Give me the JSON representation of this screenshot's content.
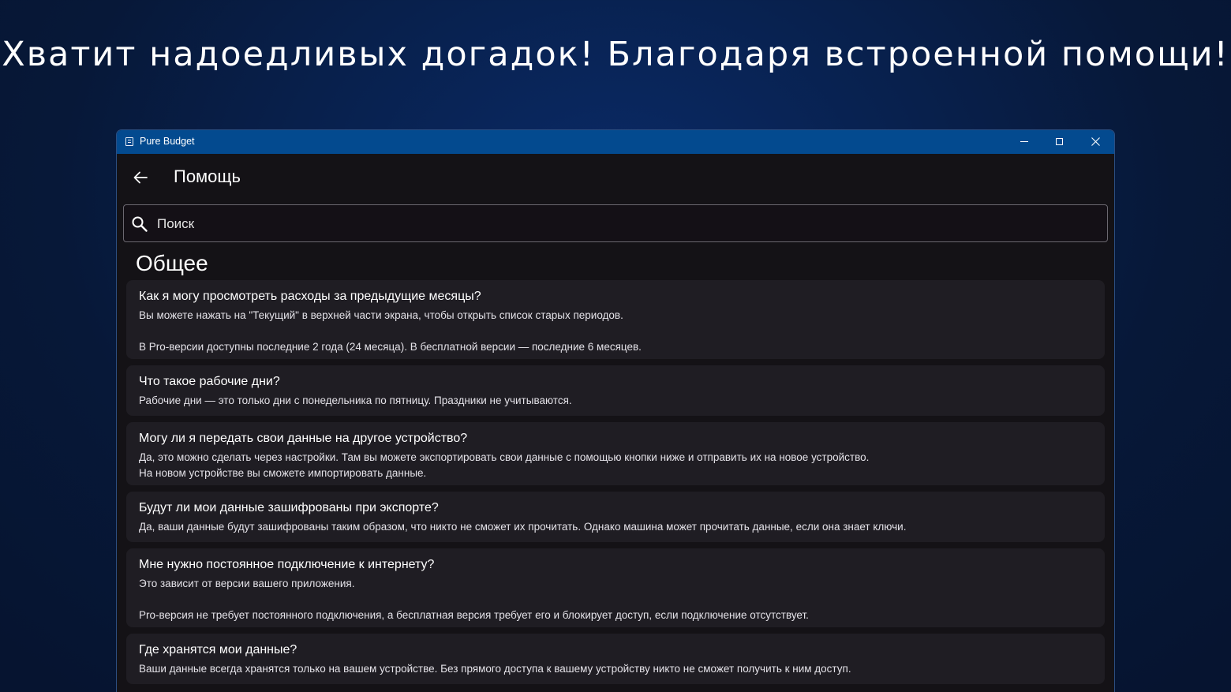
{
  "headline": "Хватит надоедливых догадок! Благодаря встроенной помощи!",
  "window": {
    "title": "Pure Budget",
    "app_icon": "app-icon",
    "controls": [
      "minimize-icon",
      "maximize-icon",
      "close-icon"
    ]
  },
  "page": {
    "back_icon": "back-arrow-icon",
    "title": "Помощь"
  },
  "search": {
    "placeholder": "Поиск",
    "value": "",
    "icon": "search-icon"
  },
  "section": {
    "title": "Общее"
  },
  "faq": [
    {
      "question": "Как я могу просмотреть расходы за предыдущие месяцы?",
      "answer": "Вы можете нажать на \"Текущий\" в верхней части экрана, чтобы открыть список старых периодов.\n\nВ Pro-версии доступны последние 2 года (24 месяца). В бесплатной версии — последние 6 месяцев."
    },
    {
      "question": "Что такое рабочие дни?",
      "answer": "Рабочие дни — это только дни с понедельника по пятницу. Праздники не учитываются."
    },
    {
      "question": "Могу ли я передать свои данные на другое устройство?",
      "answer": "Да, это можно сделать через настройки. Там вы можете экспортировать свои данные с помощью кнопки ниже и отправить их на новое устройство.\nНа новом устройстве вы сможете импортировать данные."
    },
    {
      "question": "Будут ли мои данные зашифрованы при экспорте?",
      "answer": "Да, ваши данные будут зашифрованы таким образом, что никто не сможет их прочитать. Однако машина может прочитать данные, если она знает ключи."
    },
    {
      "question": "Мне нужно постоянное подключение к интернету?",
      "answer": "Это зависит от версии вашего приложения.\n\nPro-версия не требует постоянного подключения, а бесплатная версия требует его и блокирует доступ, если подключение отсутствует."
    },
    {
      "question": "Где хранятся мои данные?",
      "answer": "Ваши данные всегда хранятся только на вашем устройстве. Без прямого доступа к вашему устройству никто не сможет получить к ним доступ."
    }
  ],
  "colors": {
    "background": "#071838",
    "titlebar": "#034a8f",
    "window_bg": "#141216",
    "card_bg": "#1f1d23",
    "text": "#ffffff"
  }
}
